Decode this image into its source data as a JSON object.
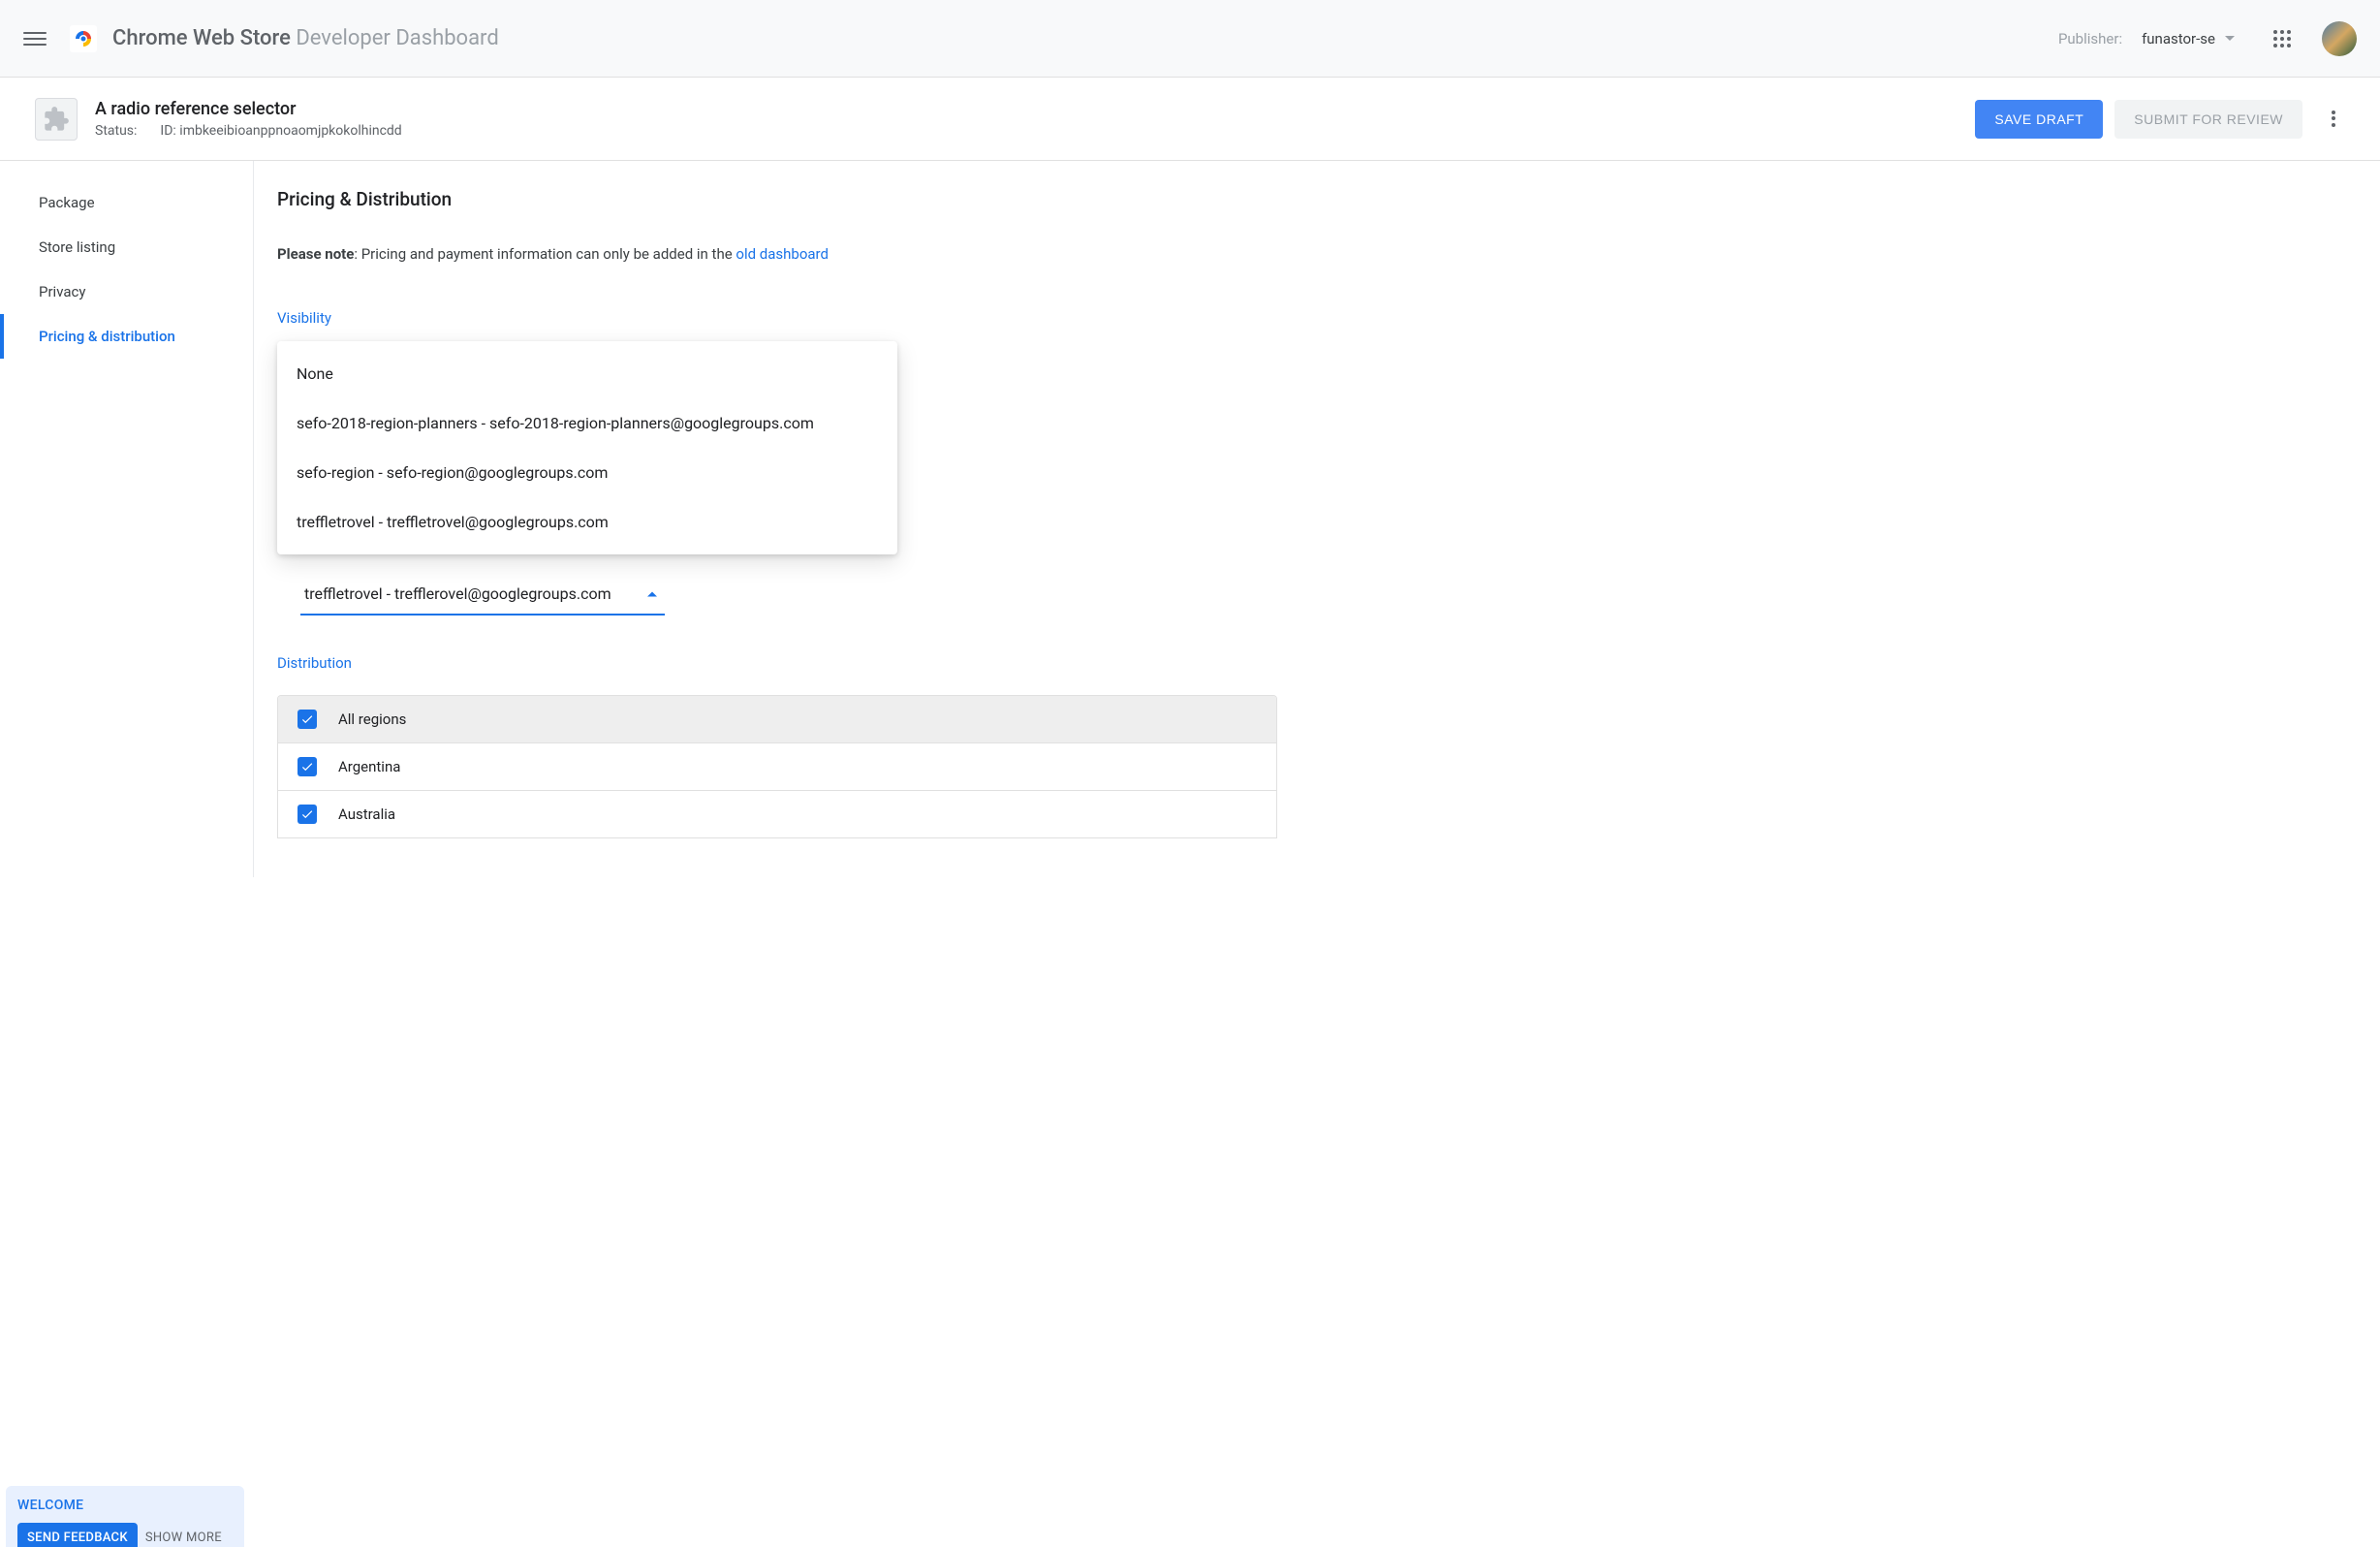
{
  "header": {
    "title_bold": "Chrome Web Store",
    "title_light": "Developer Dashboard",
    "publisher_label": "Publisher:",
    "publisher_value": "funastor-se"
  },
  "item": {
    "title": "A radio reference selector",
    "status_label": "Status:",
    "id_label": "ID:",
    "id_value": "imbkeeibioanppnoaomjpkokolhincdd",
    "save_draft": "SAVE DRAFT",
    "submit_review": "SUBMIT FOR REVIEW"
  },
  "sidebar": {
    "items": [
      {
        "label": "Package"
      },
      {
        "label": "Store listing"
      },
      {
        "label": "Privacy"
      },
      {
        "label": "Pricing & distribution"
      }
    ]
  },
  "main": {
    "page_title": "Pricing & Distribution",
    "note_prefix": "Please note",
    "note_text": ": Pricing and payment information can only be added in the ",
    "note_link": "old dashboard",
    "visibility_label": "Visibility"
  },
  "dropdown": {
    "options": [
      "None",
      "sefo-2018-region-planners - sefo-2018-region-planners@googlegroups.com",
      "sefo-region - sefo-region@googlegroups.com",
      "treffletrovel - treffletrovel@googlegroups.com"
    ]
  },
  "select": {
    "value": "treffletrovel - trefflerovel@googlegroups.com"
  },
  "distribution": {
    "label": "Distribution",
    "rows": [
      {
        "label": "All regions"
      },
      {
        "label": "Argentina"
      },
      {
        "label": "Australia"
      }
    ]
  },
  "welcome": {
    "title": "WELCOME",
    "send_feedback": "SEND FEEDBACK",
    "show_more": "SHOW MORE"
  }
}
